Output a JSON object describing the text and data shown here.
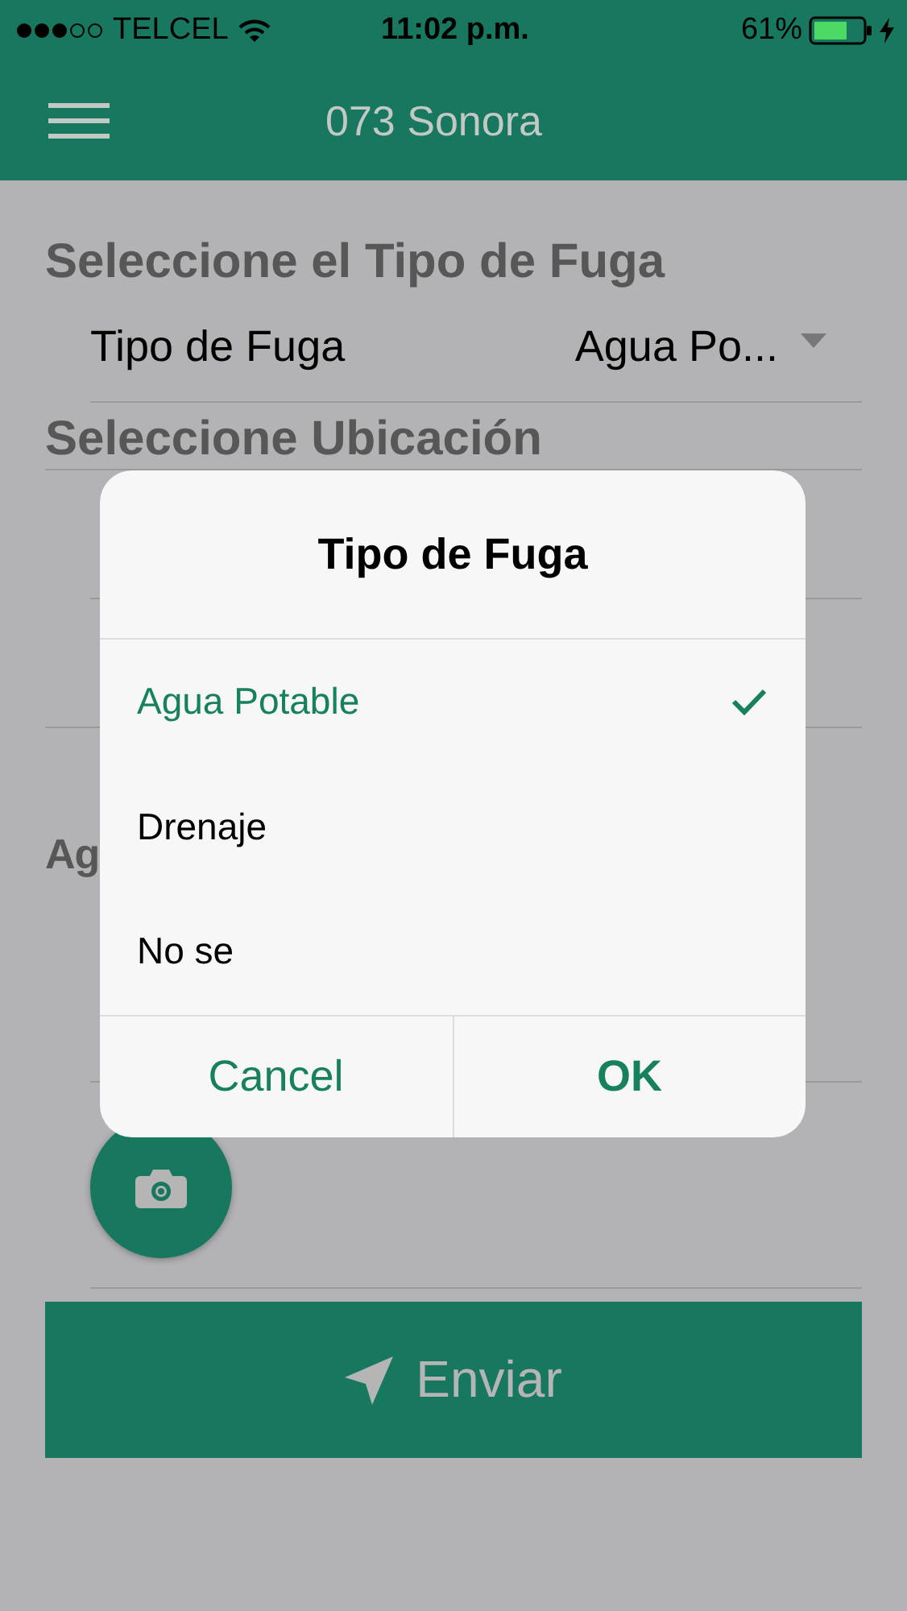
{
  "status_bar": {
    "carrier": "TELCEL",
    "time": "11:02 p.m.",
    "battery": "61%"
  },
  "nav": {
    "title": "073 Sonora"
  },
  "form": {
    "heading": "Seleccione el Tipo de Fuga",
    "picker": {
      "label": "Tipo de Fuga",
      "value": "Agua Po..."
    },
    "location_heading": "Seleccione Ubicación",
    "section_3_heading": "Ag",
    "submit": "Enviar"
  },
  "dialog": {
    "title": "Tipo de Fuga",
    "options": [
      {
        "label": "Agua Potable",
        "selected": true
      },
      {
        "label": "Drenaje",
        "selected": false
      },
      {
        "label": "No se",
        "selected": false
      }
    ],
    "buttons": [
      {
        "label": "Cancel",
        "kind": "cancel"
      },
      {
        "label": "OK",
        "kind": "confirm"
      }
    ]
  }
}
